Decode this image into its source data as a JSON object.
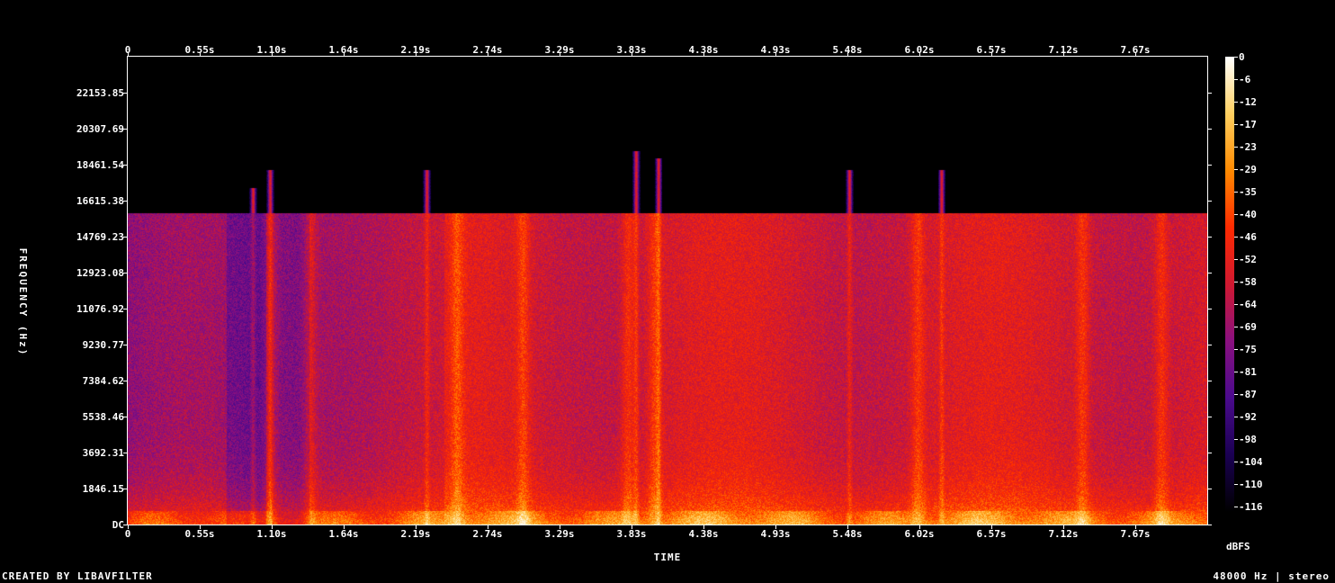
{
  "chart_data": {
    "type": "heatmap",
    "title": "",
    "xlabel": "TIME",
    "ylabel": "FREQUENCY (Hz)",
    "x_ticks": [
      "0",
      "0.55s",
      "1.10s",
      "1.64s",
      "2.19s",
      "2.74s",
      "3.29s",
      "3.83s",
      "4.38s",
      "4.93s",
      "5.48s",
      "6.02s",
      "6.57s",
      "7.12s",
      "7.67s"
    ],
    "y_ticks": [
      "DC",
      "1846.15",
      "3692.31",
      "5538.46",
      "7384.62",
      "9230.77",
      "11076.92",
      "12923.08",
      "14769.23",
      "16615.38",
      "18461.54",
      "20307.69",
      "22153.85"
    ],
    "y_max_hz": 24000,
    "duration_s": 8.2,
    "cutoff_hz": 16000,
    "colorbar": {
      "unit": "dBFS",
      "ticks": [
        "0",
        "-6",
        "-12",
        "-17",
        "-23",
        "-29",
        "-35",
        "-40",
        "-46",
        "-52",
        "-58",
        "-64",
        "-69",
        "-75",
        "-81",
        "-87",
        "-92",
        "-98",
        "-104",
        "-110",
        "-116"
      ],
      "range": [
        -120,
        0
      ],
      "colors": [
        "#000000",
        "#1a0052",
        "#4a0a8c",
        "#8a1080",
        "#d01830",
        "#ff2a00",
        "#ff8a00",
        "#ffd060",
        "#ffffff"
      ]
    },
    "background_level_db": -80,
    "transients": [
      {
        "t_s": 0.95,
        "top_hz": 17300
      },
      {
        "t_s": 1.08,
        "top_hz": 18200
      },
      {
        "t_s": 2.27,
        "top_hz": 18200
      },
      {
        "t_s": 3.86,
        "top_hz": 19200
      },
      {
        "t_s": 4.03,
        "top_hz": 18800
      },
      {
        "t_s": 5.48,
        "top_hz": 18200
      },
      {
        "t_s": 6.18,
        "top_hz": 18200
      }
    ],
    "bright_columns_s": [
      1.08,
      1.38,
      2.5,
      3.0,
      3.8,
      4.0,
      6.0,
      7.25,
      7.85
    ]
  },
  "footer": {
    "created_by": "CREATED BY LIBAVFILTER",
    "sample_info": "48000 Hz | stereo"
  }
}
